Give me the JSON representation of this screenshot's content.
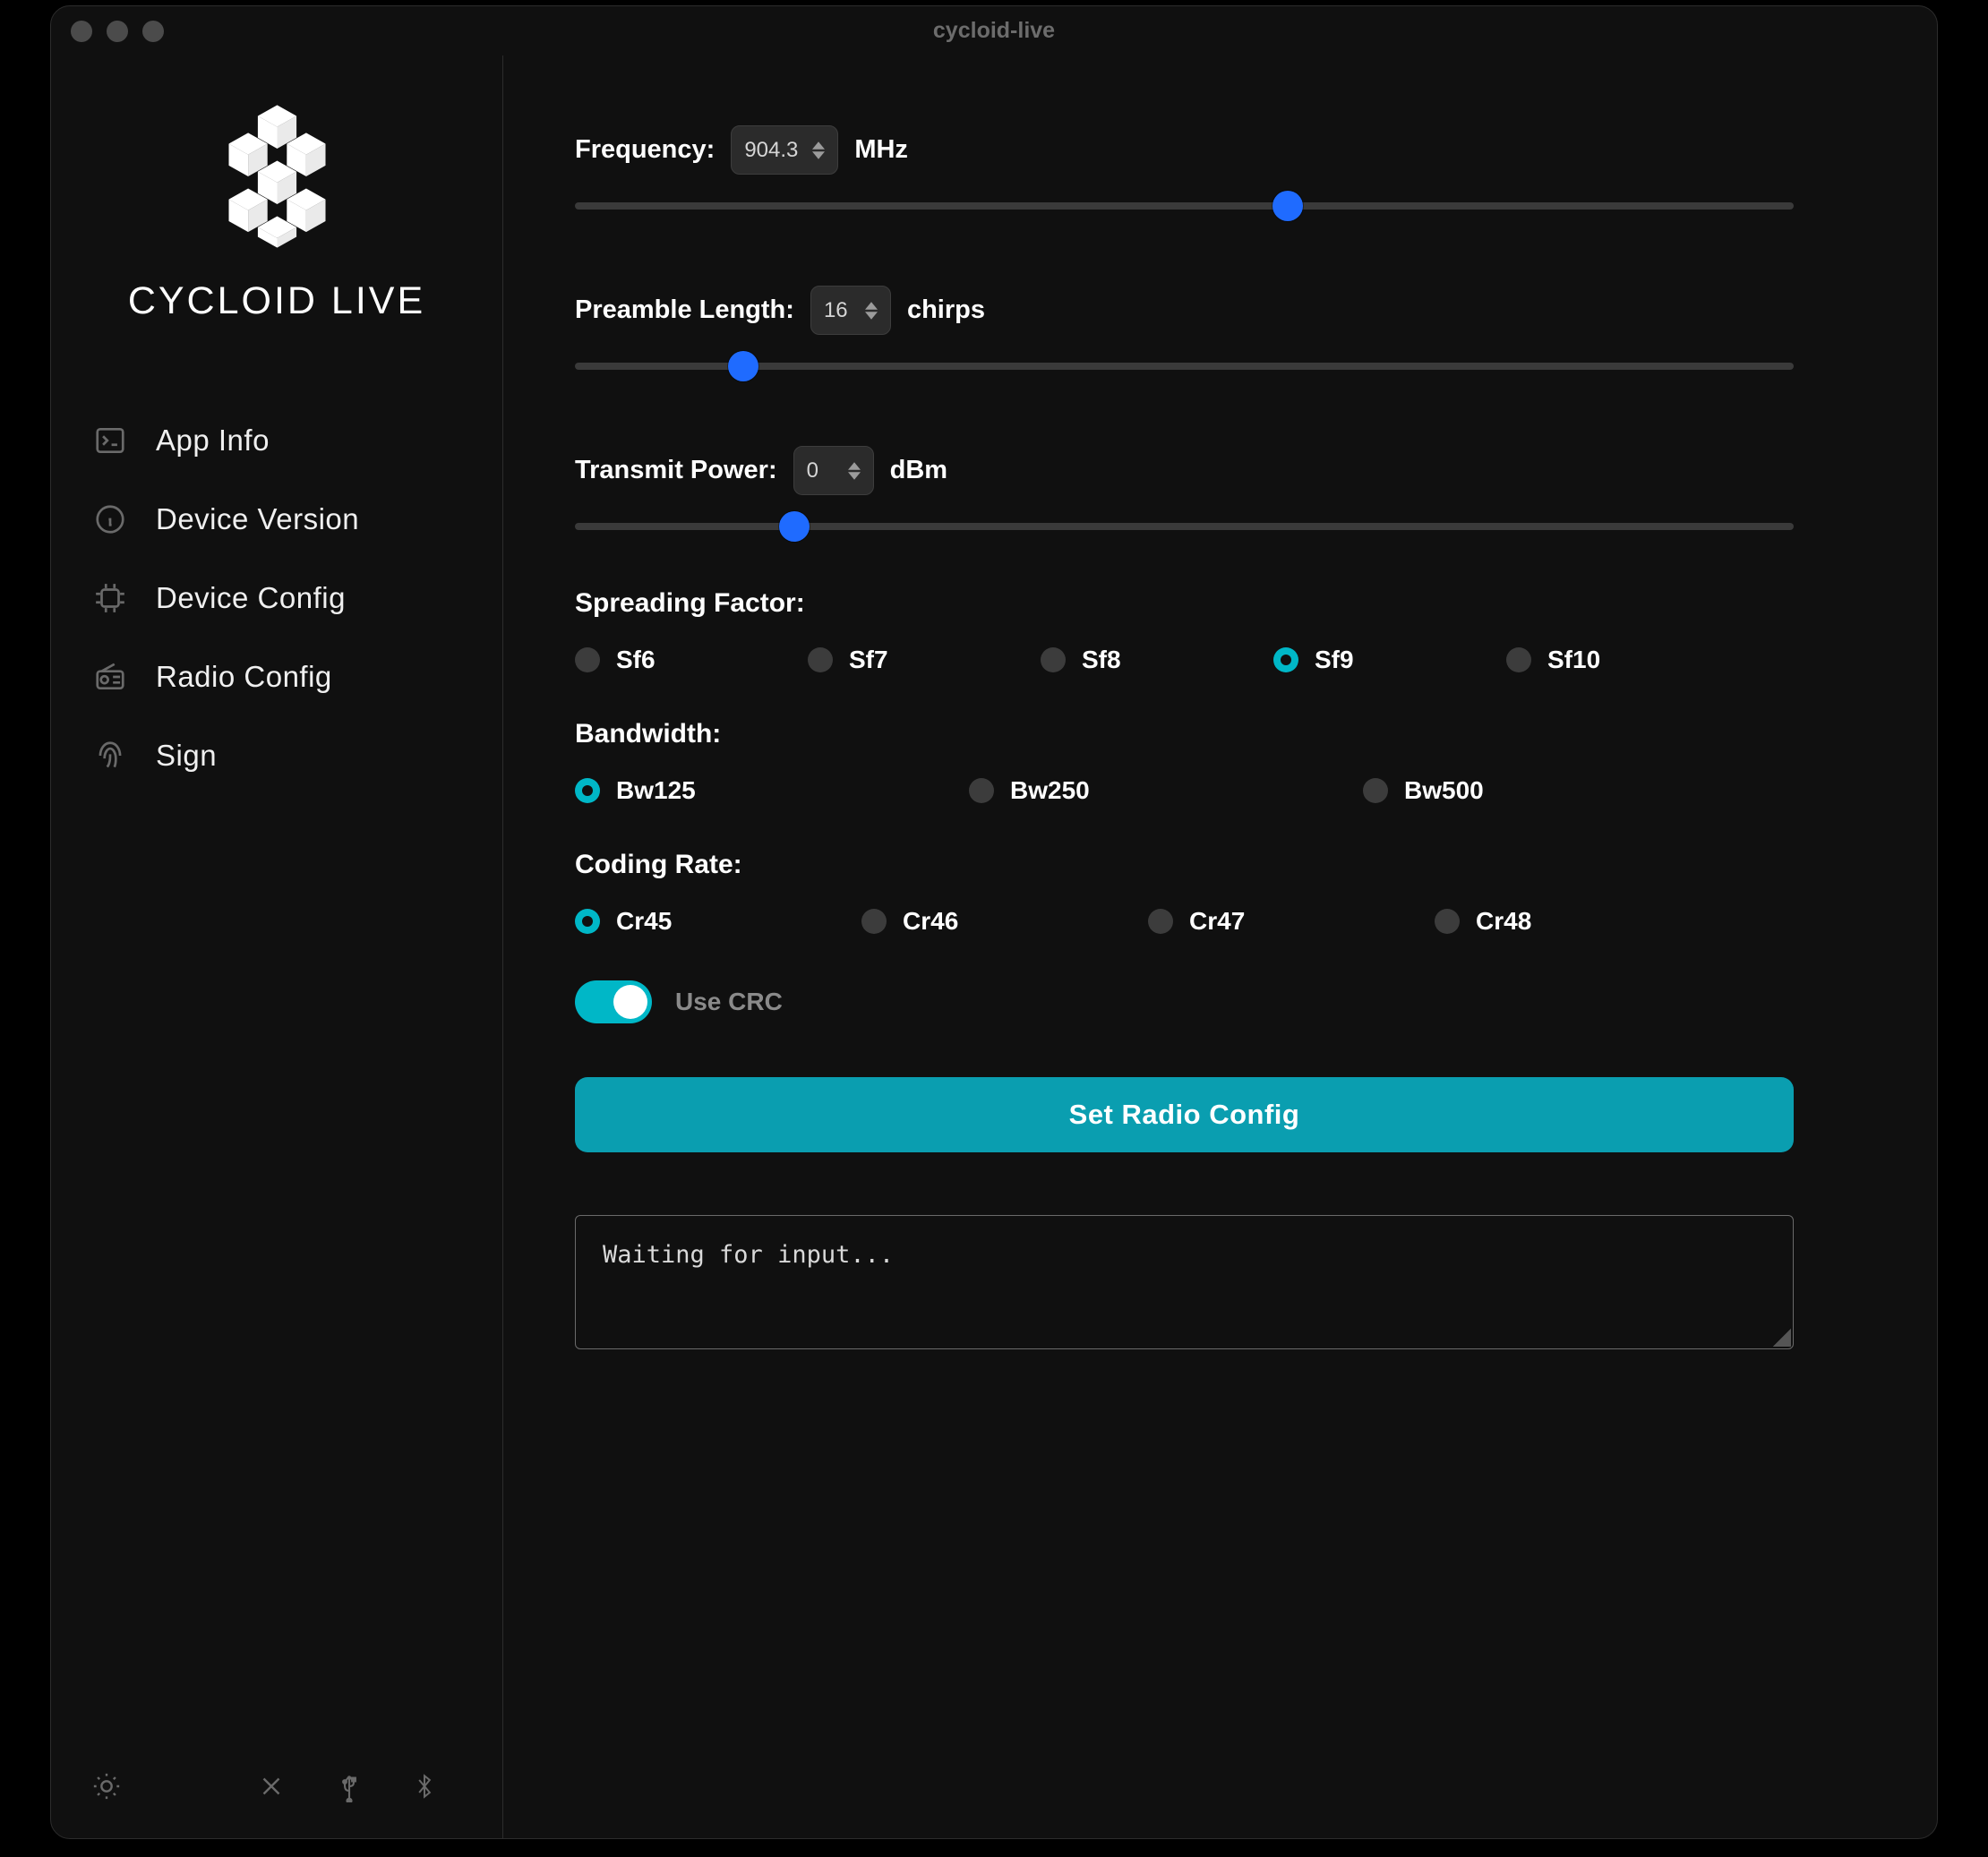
{
  "window": {
    "title": "cycloid-live"
  },
  "brand": {
    "title": "CYCLOID LIVE"
  },
  "sidebar": {
    "items": [
      {
        "label": "App Info",
        "icon": "terminal-icon"
      },
      {
        "label": "Device Version",
        "icon": "info-icon"
      },
      {
        "label": "Device Config",
        "icon": "chip-icon"
      },
      {
        "label": "Radio Config",
        "icon": "radio-icon"
      },
      {
        "label": "Sign",
        "icon": "fingerprint-icon"
      }
    ]
  },
  "frequency": {
    "label": "Frequency:",
    "value": "904.3",
    "unit": "MHz",
    "slider_pct": 58.5
  },
  "preamble": {
    "label": "Preamble Length:",
    "value": "16",
    "unit": "chirps",
    "slider_pct": 13.8
  },
  "txpower": {
    "label": "Transmit Power:",
    "value": "0",
    "unit": "dBm",
    "slider_pct": 18.0
  },
  "spreading_factor": {
    "label": "Spreading Factor:",
    "options": [
      "Sf6",
      "Sf7",
      "Sf8",
      "Sf9",
      "Sf10"
    ],
    "selected": "Sf9"
  },
  "bandwidth": {
    "label": "Bandwidth:",
    "options": [
      "Bw125",
      "Bw250",
      "Bw500"
    ],
    "selected": "Bw125"
  },
  "coding_rate": {
    "label": "Coding Rate:",
    "options": [
      "Cr45",
      "Cr46",
      "Cr47",
      "Cr48"
    ],
    "selected": "Cr45"
  },
  "crc": {
    "label": "Use CRC",
    "on": true
  },
  "submit": {
    "label": "Set Radio Config"
  },
  "console": {
    "text": "Waiting for input..."
  },
  "colors": {
    "accent_primary": "#00b7c7",
    "accent_button": "#0a9eb0",
    "slider_thumb": "#1f6bff"
  }
}
